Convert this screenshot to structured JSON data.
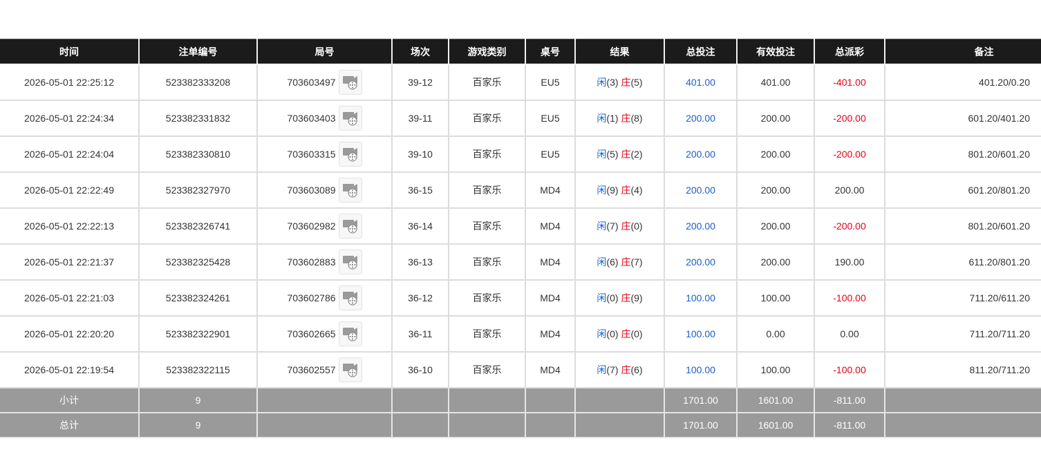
{
  "columns": [
    "时间",
    "注单编号",
    "局号",
    "场次",
    "游戏类别",
    "桌号",
    "结果",
    "总投注",
    "有效投注",
    "总派彩",
    "备注"
  ],
  "rows": [
    {
      "time": "2026-05-01 22:25:12",
      "bet_id": "523382333208",
      "round": "703603497",
      "session": "39-12",
      "game": "百家乐",
      "table": "EU5",
      "player_label": "闲",
      "player_score": "(3)",
      "banker_label": "庄",
      "banker_score": "(5)",
      "total_bet": "401.00",
      "valid_bet": "401.00",
      "payout": "-401.00",
      "payout_negative": true,
      "remark": "401.20/0.20"
    },
    {
      "time": "2026-05-01 22:24:34",
      "bet_id": "523382331832",
      "round": "703603403",
      "session": "39-11",
      "game": "百家乐",
      "table": "EU5",
      "player_label": "闲",
      "player_score": "(1)",
      "banker_label": "庄",
      "banker_score": "(8)",
      "total_bet": "200.00",
      "valid_bet": "200.00",
      "payout": "-200.00",
      "payout_negative": true,
      "remark": "601.20/401.20"
    },
    {
      "time": "2026-05-01 22:24:04",
      "bet_id": "523382330810",
      "round": "703603315",
      "session": "39-10",
      "game": "百家乐",
      "table": "EU5",
      "player_label": "闲",
      "player_score": "(5)",
      "banker_label": "庄",
      "banker_score": "(2)",
      "total_bet": "200.00",
      "valid_bet": "200.00",
      "payout": "-200.00",
      "payout_negative": true,
      "remark": "801.20/601.20"
    },
    {
      "time": "2026-05-01 22:22:49",
      "bet_id": "523382327970",
      "round": "703603089",
      "session": "36-15",
      "game": "百家乐",
      "table": "MD4",
      "player_label": "闲",
      "player_score": "(9)",
      "banker_label": "庄",
      "banker_score": "(4)",
      "total_bet": "200.00",
      "valid_bet": "200.00",
      "payout": "200.00",
      "payout_negative": false,
      "remark": "601.20/801.20"
    },
    {
      "time": "2026-05-01 22:22:13",
      "bet_id": "523382326741",
      "round": "703602982",
      "session": "36-14",
      "game": "百家乐",
      "table": "MD4",
      "player_label": "闲",
      "player_score": "(7)",
      "banker_label": "庄",
      "banker_score": "(0)",
      "total_bet": "200.00",
      "valid_bet": "200.00",
      "payout": "-200.00",
      "payout_negative": true,
      "remark": "801.20/601.20"
    },
    {
      "time": "2026-05-01 22:21:37",
      "bet_id": "523382325428",
      "round": "703602883",
      "session": "36-13",
      "game": "百家乐",
      "table": "MD4",
      "player_label": "闲",
      "player_score": "(6)",
      "banker_label": "庄",
      "banker_score": "(7)",
      "total_bet": "200.00",
      "valid_bet": "200.00",
      "payout": "190.00",
      "payout_negative": false,
      "remark": "611.20/801.20"
    },
    {
      "time": "2026-05-01 22:21:03",
      "bet_id": "523382324261",
      "round": "703602786",
      "session": "36-12",
      "game": "百家乐",
      "table": "MD4",
      "player_label": "闲",
      "player_score": "(0)",
      "banker_label": "庄",
      "banker_score": "(9)",
      "total_bet": "100.00",
      "valid_bet": "100.00",
      "payout": "-100.00",
      "payout_negative": true,
      "remark": "711.20/611.20"
    },
    {
      "time": "2026-05-01 22:20:20",
      "bet_id": "523382322901",
      "round": "703602665",
      "session": "36-11",
      "game": "百家乐",
      "table": "MD4",
      "player_label": "闲",
      "player_score": "(0)",
      "banker_label": "庄",
      "banker_score": "(0)",
      "total_bet": "100.00",
      "valid_bet": "0.00",
      "payout": "0.00",
      "payout_negative": false,
      "remark": "711.20/711.20"
    },
    {
      "time": "2026-05-01 22:19:54",
      "bet_id": "523382322115",
      "round": "703602557",
      "session": "36-10",
      "game": "百家乐",
      "table": "MD4",
      "player_label": "闲",
      "player_score": "(7)",
      "banker_label": "庄",
      "banker_score": "(6)",
      "total_bet": "100.00",
      "valid_bet": "100.00",
      "payout": "-100.00",
      "payout_negative": true,
      "remark": "811.20/711.20"
    }
  ],
  "subtotal": {
    "label": "小计",
    "count": "9",
    "total_bet": "1701.00",
    "valid_bet": "1601.00",
    "payout": "-811.00"
  },
  "grand_total": {
    "label": "总计",
    "count": "9",
    "total_bet": "1701.00",
    "valid_bet": "1601.00",
    "payout": "-811.00"
  },
  "icons": {
    "round_video": "video-replay-icon"
  },
  "colors": {
    "header_bg": "#1b1b1b",
    "bet_blue": "#1a5fc9",
    "loss_red": "#e60012",
    "summary_bg": "#9a9a9a"
  }
}
